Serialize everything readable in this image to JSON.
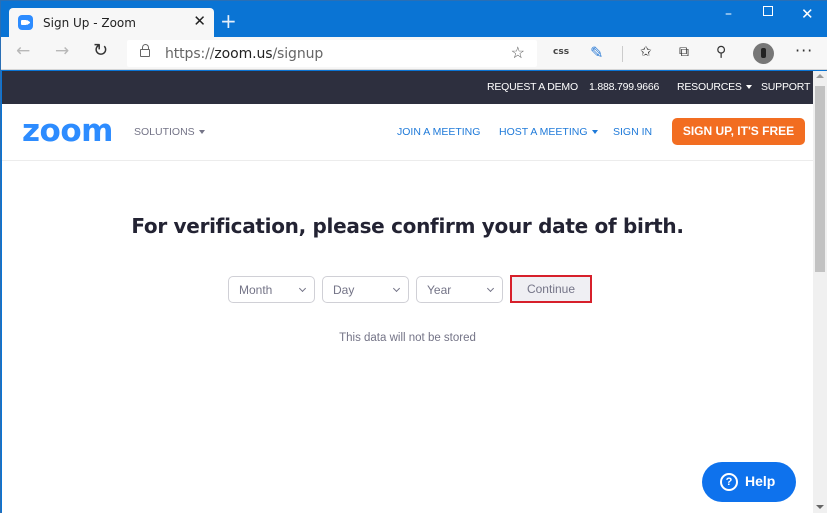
{
  "browser": {
    "tab_title": "Sign Up - Zoom",
    "tab_close": "✕",
    "new_tab": "+",
    "window_controls": {
      "minimize": "–",
      "close": "✕"
    },
    "nav": {
      "back": "←",
      "forward": "→",
      "refresh": "↻"
    },
    "url_prefix": "https://",
    "url_host": "zoom.us",
    "url_path": "/signup",
    "toolbar_icons": {
      "favorite": "☆",
      "css": "css",
      "pen": "✎",
      "favorites": "✩",
      "collections": "⧉",
      "share": "⚲",
      "more": "···"
    }
  },
  "page": {
    "topbar": {
      "request_demo": "REQUEST A DEMO",
      "phone": "1.888.799.9666",
      "resources": "RESOURCES",
      "support": "SUPPORT"
    },
    "header": {
      "logo": "zoom",
      "solutions": "SOLUTIONS",
      "join_meeting": "JOIN A MEETING",
      "host_meeting": "HOST A MEETING",
      "sign_in": "SIGN IN",
      "sign_up": "SIGN UP, IT'S FREE"
    },
    "verification": {
      "heading": "For verification, please confirm your date of birth.",
      "month_placeholder": "Month",
      "day_placeholder": "Day",
      "year_placeholder": "Year",
      "continue_label": "Continue",
      "note": "This data will not be stored"
    },
    "help": {
      "icon": "?",
      "label": "Help"
    }
  },
  "colors": {
    "browser_chrome": "#0a74d4",
    "topbar_bg": "#2d2f3e",
    "brand_blue": "#2d8cff",
    "signup_orange": "#f26d21",
    "highlight_red": "#d7202b",
    "help_blue": "#0e72ed"
  }
}
